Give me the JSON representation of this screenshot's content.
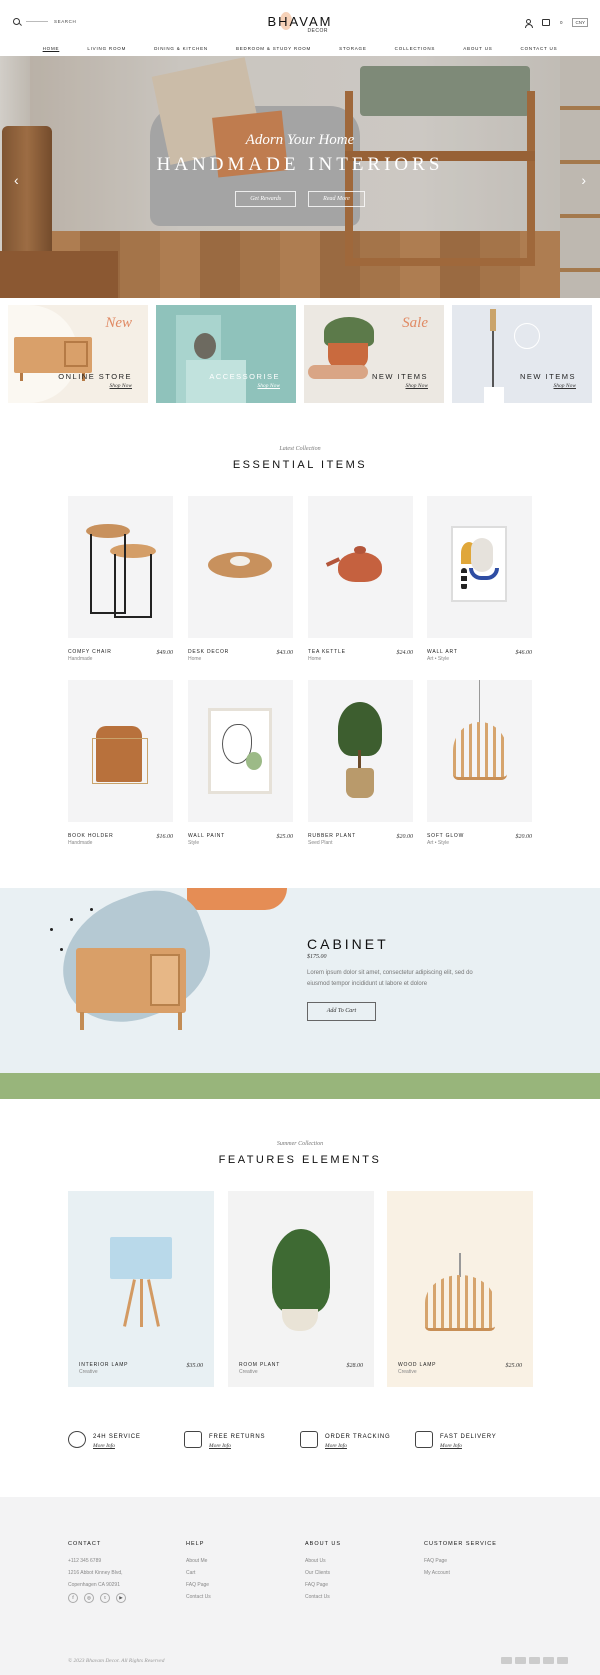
{
  "header": {
    "search_label": "SEARCH",
    "logo_line1": "BHAVAM",
    "logo_line2": "DECOR",
    "cart_count": "0",
    "currency": "CNY"
  },
  "nav": [
    {
      "label": "HOME"
    },
    {
      "label": "LIVING ROOM"
    },
    {
      "label": "DINING & KITCHEN"
    },
    {
      "label": "BEDROOM & STUDY ROOM"
    },
    {
      "label": "STORAGE"
    },
    {
      "label": "COLLECTIONS"
    },
    {
      "label": "ABOUT US"
    },
    {
      "label": "CONTACT US"
    }
  ],
  "hero": {
    "script": "Adorn Your Home",
    "title": "HANDMADE INTERIORS",
    "btn1": "Get Rewards",
    "btn2": "Read More",
    "prev": "‹",
    "next": "›"
  },
  "tiles": [
    {
      "label": "ONLINE STORE",
      "tag": "New",
      "shop": "Shop Now",
      "bg": "#f5efe6"
    },
    {
      "label": "ACCESSORISE",
      "tag": "",
      "shop": "Shop Now",
      "bg": "#8fc2bb"
    },
    {
      "label": "NEW ITEMS",
      "tag": "Sale",
      "shop": "Shop Now",
      "bg": "#ece8e2"
    },
    {
      "label": "NEW ITEMS",
      "tag": "",
      "shop": "Shop Now",
      "bg": "#e4e8ee"
    }
  ],
  "essential": {
    "script": "Latest Collection",
    "title": "ESSENTIAL ITEMS",
    "products": [
      {
        "name": "COMFY CHAIR",
        "cat": "Handmade",
        "price": "$49.00"
      },
      {
        "name": "DESK DECOR",
        "cat": "Home",
        "price": "$43.00"
      },
      {
        "name": "TEA KETTLE",
        "cat": "Home",
        "price": "$24.00"
      },
      {
        "name": "WALL ART",
        "cat": "Art • Style",
        "price": "$46.00"
      },
      {
        "name": "BOOK HOLDER",
        "cat": "Handmade",
        "price": "$16.00"
      },
      {
        "name": "WALL PAINT",
        "cat": "Style",
        "price": "$25.00"
      },
      {
        "name": "RUBBER PLANT",
        "cat": "Seed Plant",
        "price": "$20.00"
      },
      {
        "name": "SOFT GLOW",
        "cat": "Art • Style",
        "price": "$20.00"
      }
    ]
  },
  "promo": {
    "title": "CABINET",
    "price": "$175.00",
    "desc": "Lorem ipsum dolor sit amet, consectetur adipiscing elit, sed do eiusmod tempor incididunt ut labore et dolore",
    "button": "Add To Cart"
  },
  "features": {
    "script": "Summer Collection",
    "title": "FEATURES ELEMENTS",
    "products": [
      {
        "name": "INTERIOR LAMP",
        "cat": "Creative",
        "price": "$35.00",
        "bg": "#e8f0f3"
      },
      {
        "name": "ROOM PLANT",
        "cat": "Creative",
        "price": "$28.00",
        "bg": "#f3f3f3"
      },
      {
        "name": "WOOD LAMP",
        "cat": "Creative",
        "price": "$25.00",
        "bg": "#f9f1e4"
      }
    ]
  },
  "services": [
    {
      "title": "24H SERVICE",
      "more": "More Info",
      "icon": "globe-icon"
    },
    {
      "title": "FREE RETURNS",
      "more": "More Info",
      "icon": "wallet-icon"
    },
    {
      "title": "ORDER TRACKING",
      "more": "More Info",
      "icon": "truck-tracking-icon"
    },
    {
      "title": "FAST DELIVERY",
      "more": "More Info",
      "icon": "delivery-truck-icon"
    }
  ],
  "footer": {
    "contact": {
      "title": "CONTACT",
      "lines": [
        "+112 345 6789",
        "1216 Abbot Kinney Blvd,",
        "Copenhagen CA 90291"
      ]
    },
    "help": {
      "title": "HELP",
      "lines": [
        "About Me",
        "Cart",
        "FAQ Page",
        "Contact Us"
      ]
    },
    "about": {
      "title": "ABOUT US",
      "lines": [
        "About Us",
        "Our Clients",
        "FAQ Page",
        "Contact Us"
      ]
    },
    "service": {
      "title": "CUSTOMER SERVICE",
      "lines": [
        "FAQ Page",
        "My Account"
      ]
    },
    "social": [
      "f",
      "◎",
      "t",
      "▶"
    ],
    "copyright": "© 2023 Bhavam Decor. All Rights Reserved"
  }
}
